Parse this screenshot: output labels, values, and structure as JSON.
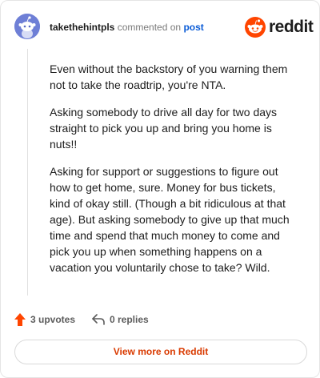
{
  "header": {
    "username": "takethehintpls",
    "commented_on": "commented on",
    "post_link": "post",
    "brand": "reddit"
  },
  "comment": {
    "paragraphs": [
      "Even without the backstory of you warning them not to take the roadtrip, you're NTA.",
      "Asking somebody to drive all day for two days straight to pick you up and bring you home is nuts!!",
      "Asking for support or suggestions to figure out how to get home, sure. Money for bus tickets, kind of okay still. (Though a bit ridiculous at that age). But asking somebody to give up that much time and spend that much money to come and pick you up when something happens on a vacation you voluntarily chose to take? Wild."
    ]
  },
  "actions": {
    "upvotes": "3 upvotes",
    "replies": "0 replies"
  },
  "view_more": "View more on Reddit",
  "colors": {
    "accent": "#ff4500",
    "link": "#0a5bd6",
    "view_more_text": "#d93a00",
    "avatar": "#6e7fd6"
  },
  "icons": {
    "avatar": "snoo-avatar-icon",
    "logo": "reddit-logo-icon",
    "upvote": "upvote-arrow-icon",
    "reply": "reply-arrow-icon"
  }
}
